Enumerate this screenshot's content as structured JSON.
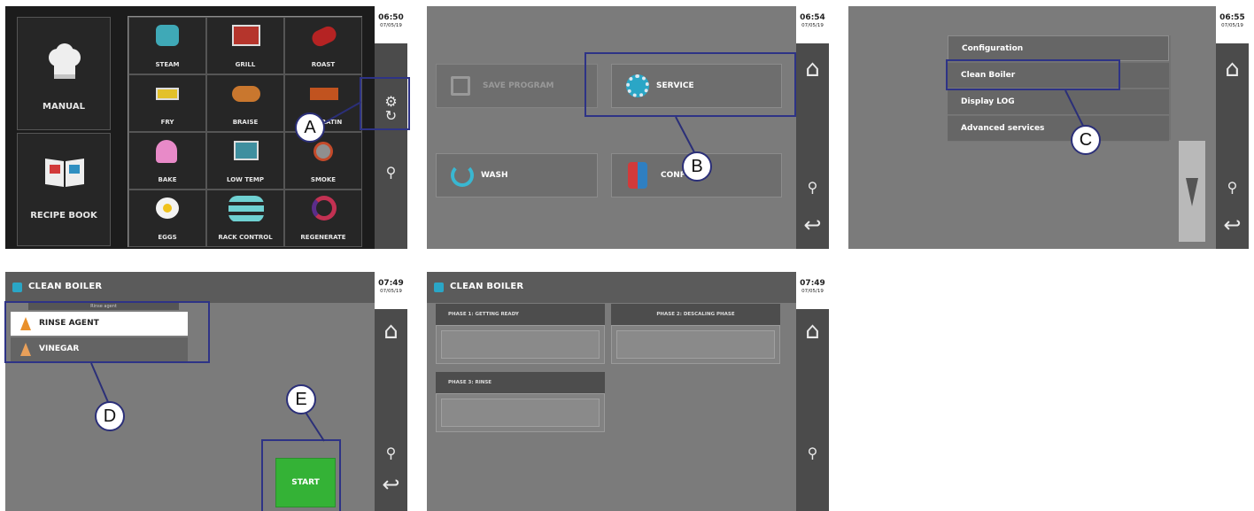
{
  "screens": {
    "s1": {
      "clock": {
        "time": "06:50",
        "date": "07/05/19"
      },
      "big": [
        {
          "label": "MANUAL",
          "icon": "chef-hat-icon"
        },
        {
          "label": "RECIPE BOOK",
          "icon": "recipe-book-icon"
        }
      ],
      "grid": [
        {
          "label": "STEAM",
          "icon": "steam-icon"
        },
        {
          "label": "GRILL",
          "icon": "grill-icon"
        },
        {
          "label": "ROAST",
          "icon": "roast-icon"
        },
        {
          "label": "FRY",
          "icon": "fry-icon"
        },
        {
          "label": "BRAISE",
          "icon": "braise-icon"
        },
        {
          "label": "AU GRATIN",
          "icon": "gratin-icon"
        },
        {
          "label": "BAKE",
          "icon": "bake-icon"
        },
        {
          "label": "LOW TEMP",
          "icon": "low-temp-icon"
        },
        {
          "label": "SMOKE",
          "icon": "smoke-icon"
        },
        {
          "label": "EGGS",
          "icon": "eggs-icon"
        },
        {
          "label": "RACK CONTROL",
          "icon": "rack-control-icon"
        },
        {
          "label": "REGENERATE",
          "icon": "regenerate-icon"
        }
      ]
    },
    "s2": {
      "clock": {
        "time": "06:54",
        "date": "07/05/19"
      },
      "buttons": {
        "save": "SAVE PROGRAM",
        "service": "SERVICE",
        "wash": "WASH",
        "config": "CONFIG"
      }
    },
    "s3": {
      "clock": {
        "time": "06:55",
        "date": "07/05/19"
      },
      "menu": [
        "Configuration",
        "Clean Boiler",
        "Display LOG",
        "Advanced services"
      ]
    },
    "s4": {
      "clock": {
        "time": "07:49",
        "date": "07/05/19"
      },
      "title": "CLEAN BOILER",
      "list_header": "Rinse agent",
      "options": [
        "RINSE AGENT",
        "VINEGAR"
      ],
      "start": "START"
    },
    "s5": {
      "clock": {
        "time": "07:49",
        "date": "07/05/19"
      },
      "title": "CLEAN BOILER",
      "phases": [
        "PHASE 1: GETTING READY",
        "PHASE 2: DESCALING PHASE",
        "PHASE 3: RINSE"
      ]
    }
  },
  "callouts": {
    "a": "A",
    "b": "B",
    "c": "C",
    "d": "D",
    "e": "E"
  },
  "colors": {
    "highlight": "#2e3386",
    "start_green": "#34b236",
    "accent_teal": "#2aa6c6"
  }
}
